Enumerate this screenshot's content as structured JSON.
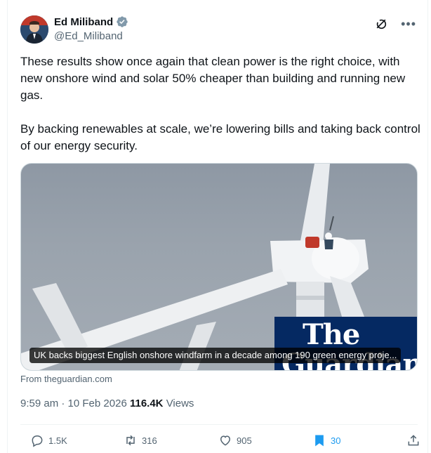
{
  "author": {
    "name": "Ed Miliband",
    "handle": "@Ed_Miliband",
    "verified_icon": "verified-badge-icon"
  },
  "tweet": {
    "paragraphs": [
      "These results show once again that clean power is the right choice, with new onshore wind and solar 50% cheaper than building and running new gas.",
      "By backing renewables at scale, we’re lowering bills and taking back control of our energy security."
    ]
  },
  "media": {
    "logo_line1": "The",
    "logo_line2": "Guardian",
    "caption": "UK backs biggest English onshore windfarm in a decade among 190 green energy proje..."
  },
  "source": "From theguardian.com",
  "meta": {
    "time": "9:59 am",
    "separator": " · ",
    "date": "10 Feb 2026",
    "views_count": "116.4K",
    "views_label": "Views"
  },
  "actions": {
    "replies": "1.5K",
    "reposts": "316",
    "likes": "905",
    "bookmarks": "30"
  },
  "colors": {
    "accent": "#1d9bf0",
    "muted": "#536471",
    "text": "#0f1419",
    "guardian_blue": "#052962"
  }
}
